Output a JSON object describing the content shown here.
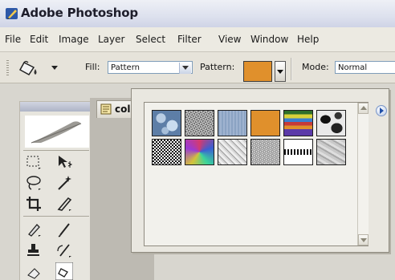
{
  "window": {
    "title": "Adobe Photoshop"
  },
  "menubar": {
    "items": [
      "File",
      "Edit",
      "Image",
      "Layer",
      "Select",
      "Filter",
      "View",
      "Window",
      "Help"
    ]
  },
  "options": {
    "fill_label": "Fill:",
    "fill_value": "Pattern",
    "pattern_label": "Pattern:",
    "pattern_color": "#e0902c",
    "mode_label": "Mode:",
    "mode_value": "Normal"
  },
  "document": {
    "title": "col"
  },
  "pattern_picker": {
    "patterns": [
      "blue-bubbles",
      "metal-landscape",
      "blue-cloth",
      "orange-solid",
      "rainbow-stripes",
      "black-marble",
      "checker-fine",
      "tie-dye",
      "gray-paper",
      "gray-granite",
      "stripe-weave",
      "gray-texture"
    ]
  },
  "colors": {
    "accent_orange": "#e0902c",
    "menu_blue": "#1f4fa8"
  }
}
